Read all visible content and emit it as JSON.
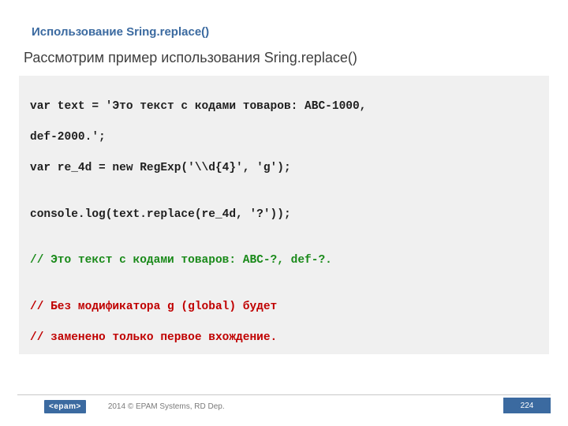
{
  "header": {
    "title": "Использование Sring.replace()"
  },
  "subtitle": "Рассмотрим пример использования Sring.replace()",
  "code": {
    "l1": "var text = 'Это текст с кодами товаров: ABC-1000,",
    "l2": "def-2000.';",
    "l3": "var re_4d = new RegExp('\\\\d{4}', 'g');",
    "l4": "",
    "l5": "console.log(text.replace(re_4d, '?'));",
    "l6": "",
    "l7": "// Это текст с кодами товаров: ABC-?, def-?.",
    "l8": "",
    "l9": "// Без модификатора g (global) будет",
    "l10": "// заменено только первое вхождение."
  },
  "footer": {
    "logo": "<epam>",
    "copyright": "2014 © EPAM Systems, RD Dep.",
    "page": "224"
  }
}
